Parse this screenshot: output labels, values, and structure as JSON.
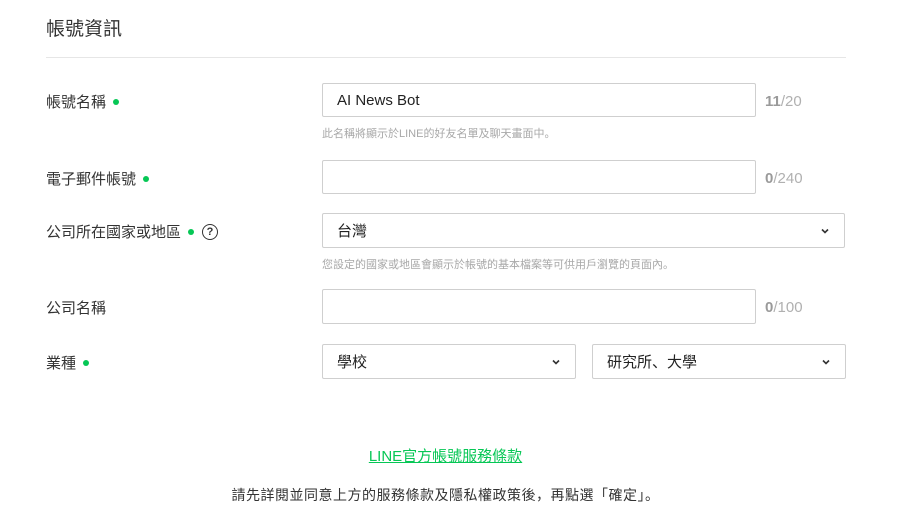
{
  "section": {
    "title": "帳號資訊"
  },
  "account_name": {
    "label": "帳號名稱",
    "value": "AI News Bot",
    "count_current": "11",
    "count_max": "/20",
    "hint": "此名稱將顯示於LINE的好友名單及聊天畫面中。"
  },
  "email": {
    "label": "電子郵件帳號",
    "value": "",
    "count_current": "0",
    "count_max": "/240"
  },
  "country": {
    "label": "公司所在國家或地區",
    "help_icon": "?",
    "selected": "台灣",
    "hint": "您設定的國家或地區會顯示於帳號的基本檔案等可供用戶瀏覽的頁面內。"
  },
  "company": {
    "label": "公司名稱",
    "value": "",
    "count_current": "0",
    "count_max": "/100"
  },
  "industry": {
    "label": "業種",
    "category_selected": "學校",
    "subcategory_selected": "研究所、大學"
  },
  "footer": {
    "terms_link": "LINE官方帳號服務條款",
    "notice": "請先詳閱並同意上方的服務條款及隱私權政策後，再點選「確定」。"
  },
  "colors": {
    "accent": "#06c755",
    "border": "#cfcfcf",
    "muted": "#a8a8a8"
  },
  "icons": {
    "required": "required-dot-icon",
    "help": "help-circle-icon",
    "dropdown": "chevron-down-icon"
  }
}
